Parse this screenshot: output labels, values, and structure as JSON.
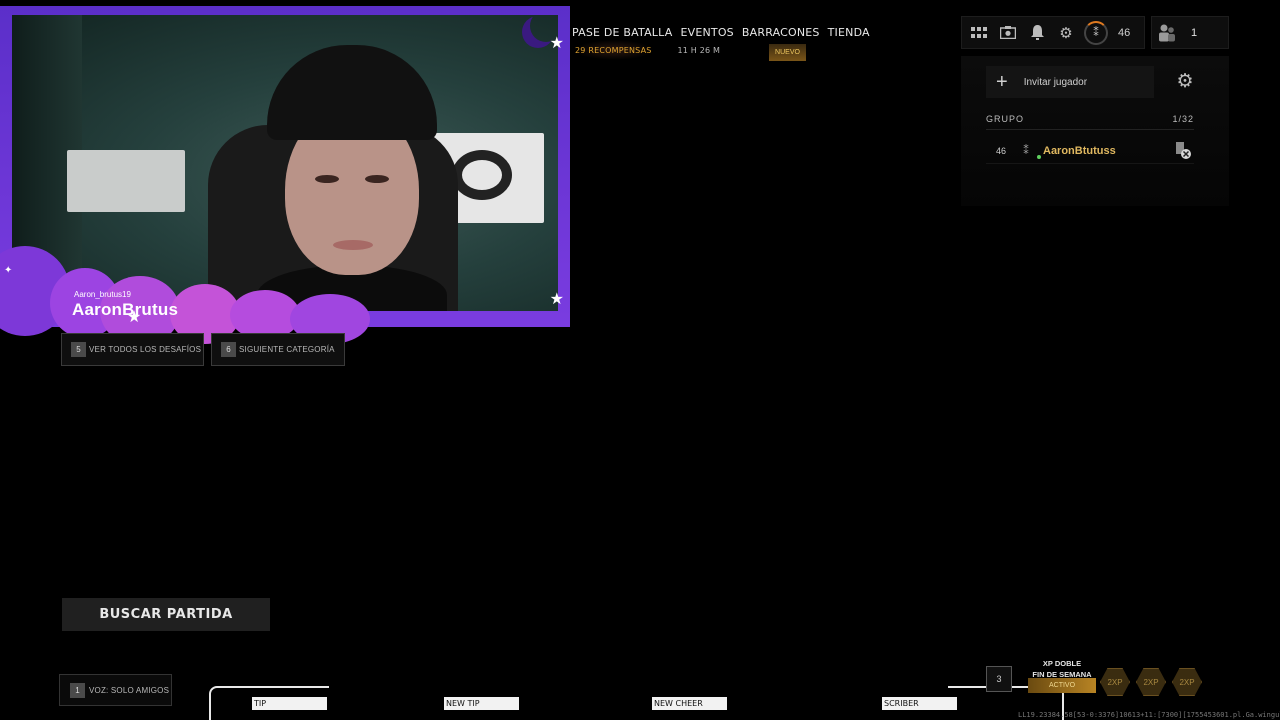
{
  "webcam": {
    "handle": "Aaron_brutus19",
    "display_name": "AaronBrutus"
  },
  "nav": {
    "items": [
      {
        "label": "PASE DE BATALLA",
        "sub": "29 RECOMPENSAS"
      },
      {
        "label": "EVENTOS",
        "sub": "11 H 26 M"
      },
      {
        "label": "BARRACONES",
        "sub": ""
      },
      {
        "label": "TIENDA",
        "sub": "NUEVO"
      }
    ]
  },
  "topbar": {
    "icons": [
      "grid-icon",
      "camera-icon",
      "bell-icon",
      "gear-icon"
    ],
    "level": "46"
  },
  "party": {
    "count": "1"
  },
  "panel": {
    "invite_label": "Invitar jugador",
    "group_label": "GRUPO",
    "group_count": "1/32",
    "members": [
      {
        "level": "46",
        "name": "AaronBtutuss"
      }
    ]
  },
  "challenges": {
    "view_all": {
      "key": "5",
      "label": "VER TODOS LOS DESAFÍOS"
    },
    "next_category": {
      "key": "6",
      "label": "SIGUIENTE CATEGORÍA"
    }
  },
  "search_match": "BUSCAR PARTIDA",
  "voice": {
    "key": "1",
    "label": "VOZ: SOLO AMIGOS"
  },
  "alerts": {
    "tip1": "TIP",
    "tip2": "NEW TIP",
    "cheer": "NEW CHEER",
    "sub": "SCRIBER"
  },
  "double_xp": {
    "key": "3",
    "title_line1": "XP DOBLE",
    "title_line2": "FIN DE SEMANA",
    "status": "ACTIVO",
    "badge": "2XP"
  },
  "build_info": "LL19.23384.58[53-0:3376]10613+11:[7300][1755453601.pl.Ga.wingulX",
  "colors": {
    "overlay_purple": "#6a34d4",
    "gold": "#e0a430",
    "member_gold": "#e0b860"
  }
}
